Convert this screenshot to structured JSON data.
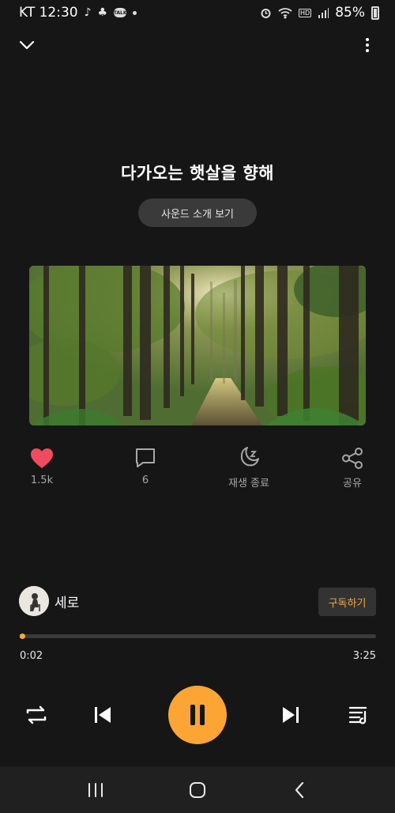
{
  "status": {
    "carrier_time": "KT 12:30",
    "talk_badge": "TALK",
    "network_badge": "HD",
    "battery": "85%"
  },
  "player": {
    "title": "다가오는 햇살을 향해",
    "intro_label": "사운드 소개 보기",
    "progress_fraction": 0.006,
    "current_time": "0:02",
    "total_time": "3:25"
  },
  "actions": {
    "likes": "1.5k",
    "comments": "6",
    "sleep_label": "재생 종료",
    "share_label": "공유"
  },
  "artist": {
    "name": "세로",
    "subscribe_label": "구독하기"
  },
  "colors": {
    "accent": "#f5a83b",
    "play_button": "#fca535",
    "like_heart": "#ef4b5f"
  }
}
